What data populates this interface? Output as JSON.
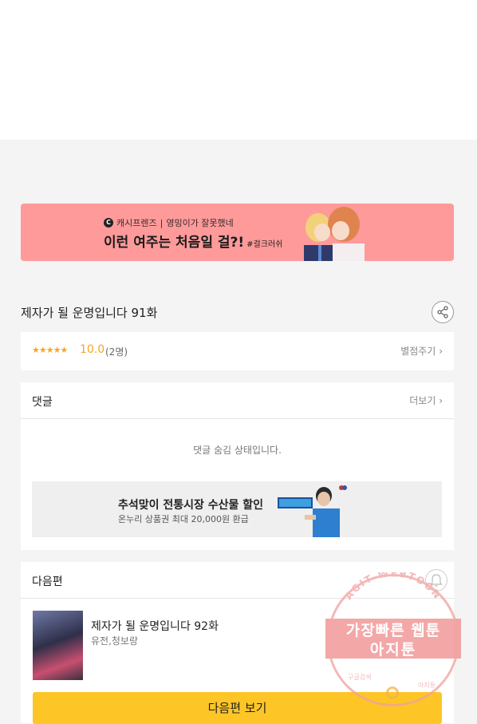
{
  "banner": {
    "brand": "캐시프렌즈",
    "series": "영밍이가 잘못했네",
    "headline": "이런 여주는 처음일 걸?!",
    "hashtag": "#걸크러쉬"
  },
  "episode": {
    "title": "제자가 될 운명입니다 91화"
  },
  "rating": {
    "stars": "★★★★★",
    "score": "10.0",
    "count": "(2명)",
    "rate_link": "별점주기"
  },
  "comments": {
    "label": "댓글",
    "more_link": "더보기",
    "hidden_message": "댓글 숨김 상태입니다."
  },
  "ad": {
    "title": "추석맞이 전통시장 수산물 할인",
    "subtitle": "온누리 상품권 최대 20,000원 환급"
  },
  "next": {
    "label": "다음편",
    "title": "제자가 될 운명입니다 92화",
    "authors": "유전,청보랑",
    "button": "다음편 보기"
  },
  "watermark": {
    "arc_text": "AGIT WEBTOON",
    "line1": "가장빠른 웹툰",
    "line2": "아지툰",
    "bottom_left": "구글검색",
    "bottom_right": "아지툰"
  },
  "colors": {
    "banner_bg": "#ff9a9a",
    "accent_star": "#f5a623",
    "next_button": "#fdc626"
  }
}
